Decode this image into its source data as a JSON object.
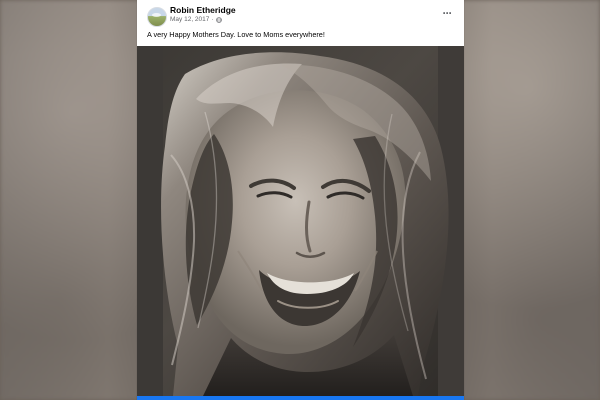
{
  "post": {
    "author_name": "Robin Etheridge",
    "date": "May 12, 2017",
    "separator": "·",
    "text": "A very Happy Mothers Day. Love to Moms everywhere!",
    "more_label": "···",
    "icons": {
      "avatar": "avatar-thumbnail",
      "audience": "globe-icon",
      "more": "more-options-icon"
    }
  },
  "colors": {
    "page_background": "#6b6259",
    "card_background": "#ffffff",
    "text_primary": "#050505",
    "text_secondary": "#65676b",
    "accent": "#1877f2"
  }
}
